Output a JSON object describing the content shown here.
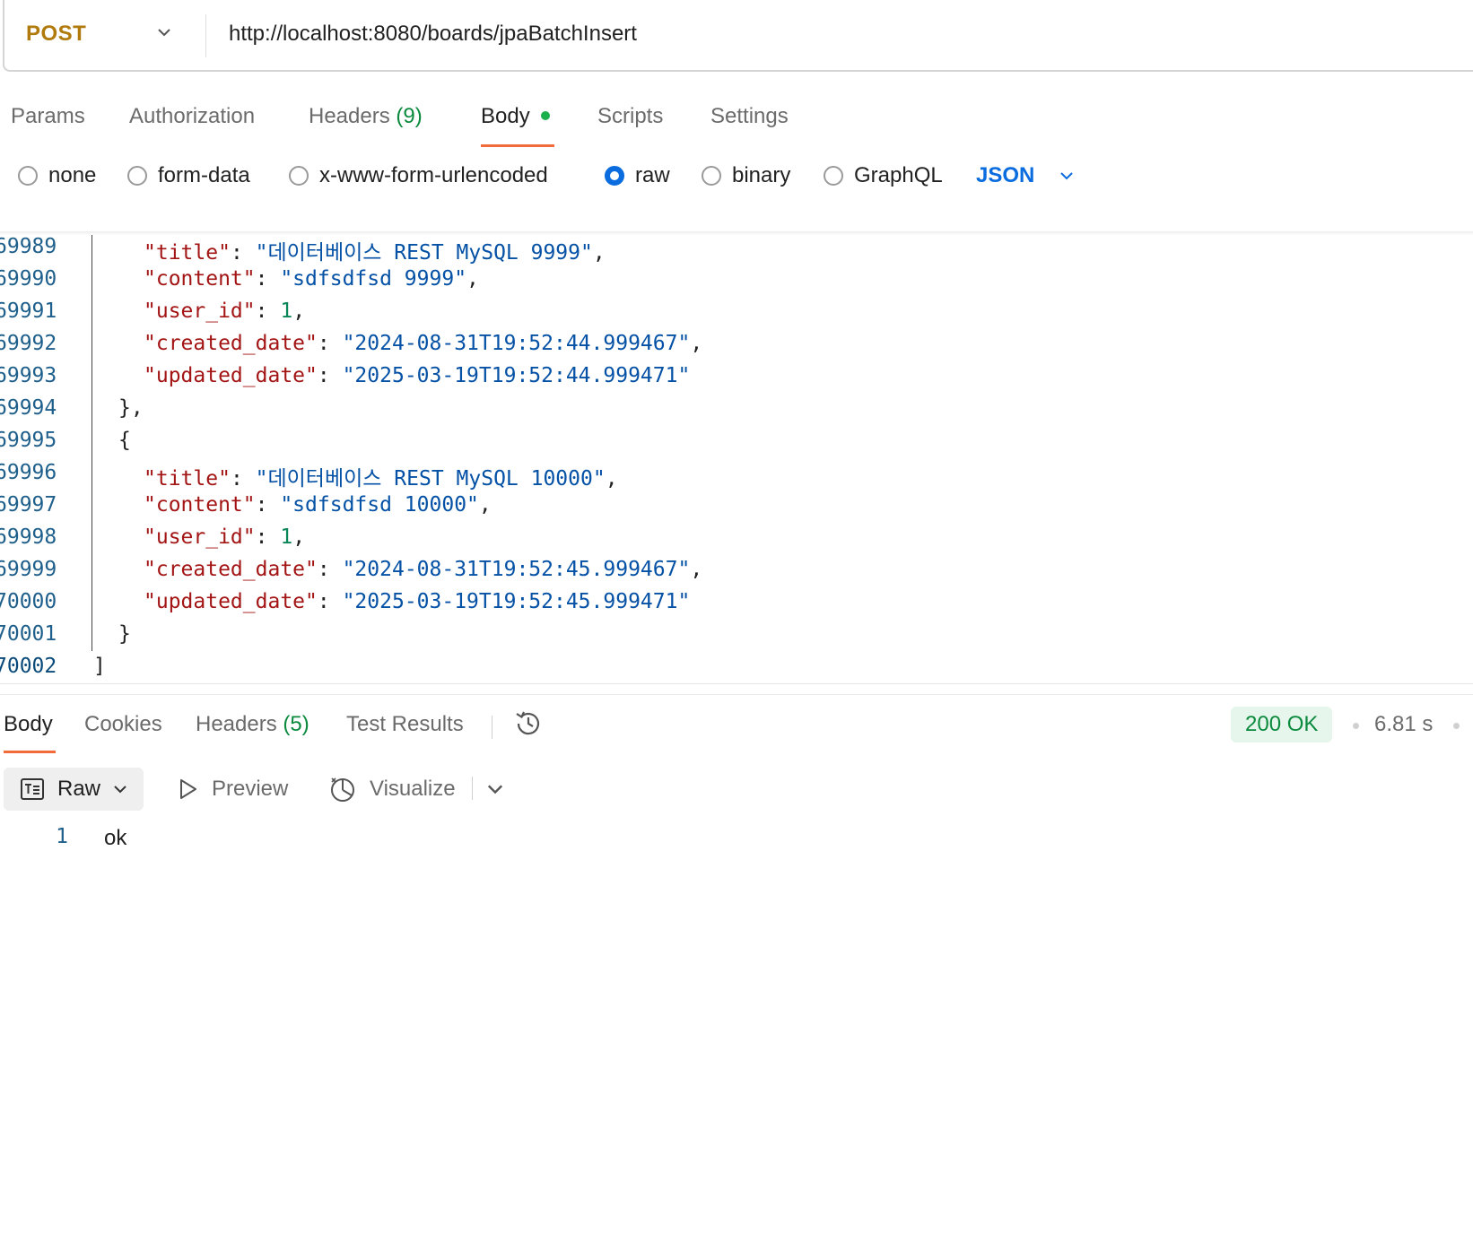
{
  "request": {
    "method": "POST",
    "url": "http://localhost:8080/boards/jpaBatchInsert"
  },
  "request_tabs": {
    "params": "Params",
    "authorization": "Authorization",
    "headers": "Headers",
    "headers_count": "(9)",
    "body": "Body",
    "scripts": "Scripts",
    "settings": "Settings"
  },
  "body_types": {
    "none": "none",
    "form_data": "form-data",
    "urlencoded": "x-www-form-urlencoded",
    "raw": "raw",
    "binary": "binary",
    "graphql": "GraphQL",
    "selected": "raw",
    "language": "JSON"
  },
  "code": {
    "line_numbers": [
      "69989",
      "69990",
      "69991",
      "69992",
      "69993",
      "69994",
      "69995",
      "69996",
      "69997",
      "69998",
      "69999",
      "70000",
      "70001",
      "70002"
    ],
    "entries": [
      {
        "title_key": "\"title\"",
        "title_val": "\"데이터베이스 REST MySQL 9999\"",
        "content_key": "\"content\"",
        "content_val": "\"sdfsdfsd 9999\"",
        "user_key": "\"user_id\"",
        "user_val": "1",
        "created_key": "\"created_date\"",
        "created_val": "\"2024-08-31T19:52:44.999467\"",
        "updated_key": "\"updated_date\"",
        "updated_val": "\"2025-03-19T19:52:44.999471\""
      },
      {
        "title_key": "\"title\"",
        "title_val": "\"데이터베이스 REST MySQL 10000\"",
        "content_key": "\"content\"",
        "content_val": "\"sdfsdfsd 10000\"",
        "user_key": "\"user_id\"",
        "user_val": "1",
        "created_key": "\"created_date\"",
        "created_val": "\"2024-08-31T19:52:45.999467\"",
        "updated_key": "\"updated_date\"",
        "updated_val": "\"2025-03-19T19:52:45.999471\""
      }
    ],
    "punct": {
      "colon": ": ",
      "comma": ",",
      "close_obj_comma": "},",
      "open_obj": "{",
      "close_obj": "}",
      "close_arr": "]"
    }
  },
  "response_tabs": {
    "body": "Body",
    "cookies": "Cookies",
    "headers": "Headers",
    "headers_count": "(5)",
    "test_results": "Test Results"
  },
  "response_status": {
    "status": "200 OK",
    "time": "6.81 s",
    "status_color": "#0b8a3e"
  },
  "response_view": {
    "raw": "Raw",
    "preview": "Preview",
    "visualize": "Visualize"
  },
  "response_body": {
    "line_number": "1",
    "text": "ok"
  },
  "icons": [
    "chevron-down-icon",
    "history-icon",
    "raw-format-icon",
    "play-icon",
    "visualize-icon"
  ],
  "colors": {
    "method": "#b07b0c",
    "accent_tab": "#f26b3a",
    "json_selector": "#0a6cde",
    "json_key": "#a31515",
    "json_string": "#0451a5",
    "json_number": "#098658"
  }
}
